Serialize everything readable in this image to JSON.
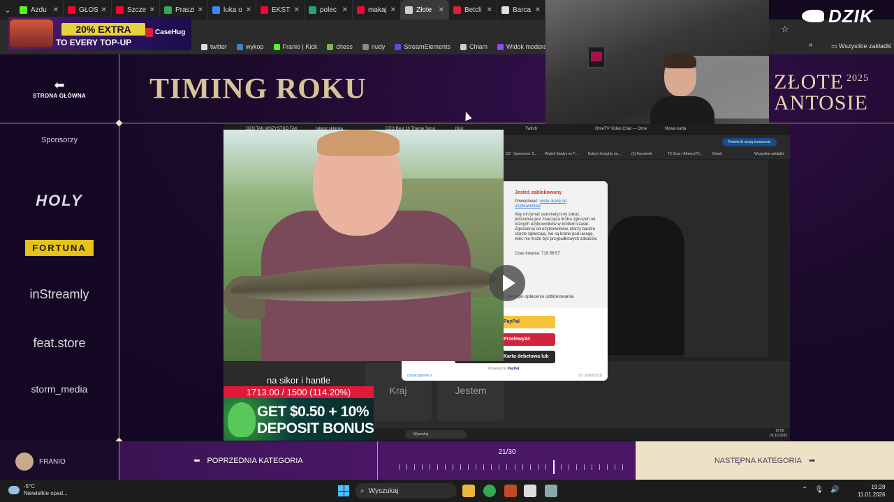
{
  "browser": {
    "tabs": [
      {
        "label": "Azdu",
        "color": "#53fc18"
      },
      {
        "label": "GŁOS",
        "color": "#ff0033"
      },
      {
        "label": "Szcze",
        "color": "#ff0033"
      },
      {
        "label": "Praszi",
        "color": "#34a853"
      },
      {
        "label": "luka o",
        "color": "#4285f4"
      },
      {
        "label": "EKSTE",
        "color": "#ff0033"
      },
      {
        "label": "polec",
        "color": "#20a37a"
      },
      {
        "label": "makaj",
        "color": "#ff0033"
      },
      {
        "label": "Złote",
        "color": "#cccccc",
        "active": true
      },
      {
        "label": "Betcli",
        "color": "#e01e3c"
      },
      {
        "label": "Barca",
        "color": "#dddddd"
      }
    ],
    "bookmarks": [
      {
        "label": "twitter",
        "color": "#dddddd"
      },
      {
        "label": "wykop",
        "color": "#3c85c8"
      },
      {
        "label": "Franio | Kick",
        "color": "#53fc18"
      },
      {
        "label": "chess",
        "color": "#81b64c"
      },
      {
        "label": "nudy",
        "color": "#888888"
      },
      {
        "label": "StreamElements",
        "color": "#5a4ae8"
      },
      {
        "label": "Chłam",
        "color": "#cccccc"
      },
      {
        "label": "Widok moderatora...",
        "color": "#9146ff"
      }
    ],
    "all_bookmarks": "Wszystkie zakładki"
  },
  "ad_top": {
    "headline": "20% EXTRA",
    "sub": "TO EVERY TOP-UP",
    "brand": "CaseHug"
  },
  "brand_logo": "DZIK",
  "page": {
    "back_label": "STRONA GŁÓWNA",
    "title": "TIMING ROKU",
    "event_line1": "ZŁOTE",
    "event_line2": "ANTOSIE",
    "event_year": "2025",
    "sponsors_heading": "Sponsorzy",
    "sponsors": [
      "HOLY",
      "FORTUNA",
      "inStreamly",
      "feat.store",
      "storm_media"
    ]
  },
  "shared_screen": {
    "tabs": [
      "OZO TAK WSZYSTKO TAK",
      "lukasz skłonka",
      "OZO Best 10 Theme Song",
      "Kick",
      "Twitch",
      "OmeTV Video Chat — Ome",
      "Nowa karta"
    ],
    "bookmarks": [
      "OZ - Summoner S...",
      "Wojtek Kardys ne T...",
      "Kubu's thoughts on...",
      "(1) Facebook",
      "T3 Zeus | AfreecaTV...",
      "Gmail",
      "Wszystkie zakładki"
    ],
    "verify_pill": "Potwierdź swoją tożsamość",
    "cards": [
      "Kraj",
      "Jestem"
    ],
    "taskbar_search": "Wyszukaj",
    "clock": "19:56",
    "date": "28.10.2025"
  },
  "modal": {
    "title": "Jesteś zablokowany",
    "reason_label": "Powodować:",
    "reason_link": "wiele skarg od użytkowników",
    "description": "Aby otrzymać automatyczny zakaz, potrzebna jest znacząca liczba zgłoszeń od różnych użytkowników w krótkim czasie. Zgłoszenia od użytkowników, którzy bardzo często zgłaszają, nie są brane pod uwagę, więc nie może być przypadkowych zakazów.",
    "duration": "Czas trwania: 719:59:57",
    "pay_note": "...mest po opłaceniu odblokowania.",
    "pay_buttons": [
      "PayPal",
      "Przelewy24",
      "Karta debetowa lub kredytowa"
    ],
    "powered_by": "Powered by",
    "powered_brand": "PayPal",
    "contact": "contact@ome.tv",
    "id": "ID: 326601718"
  },
  "goal": {
    "title": "na sikor i hantle",
    "current": 1713.0,
    "target": 1500,
    "percent": 114.2,
    "text": "1713.00 / 1500 (114.20%)"
  },
  "ad_bottom": {
    "line1": "GET $0.50 + 10%",
    "line2": "DEPOSIT BONUS"
  },
  "bottom_nav": {
    "user": "FRANIO",
    "prev": "POPRZEDNIA KATEGORIA",
    "next": "NASTĘPNA KATEGORIA",
    "counter": "21/30",
    "current": 21,
    "total": 30
  },
  "taskbar": {
    "temp": "-5°C",
    "weather": "Niewielkie opad...",
    "search": "Wyszukaj",
    "time": "19:28",
    "date": "11.01.2026"
  }
}
